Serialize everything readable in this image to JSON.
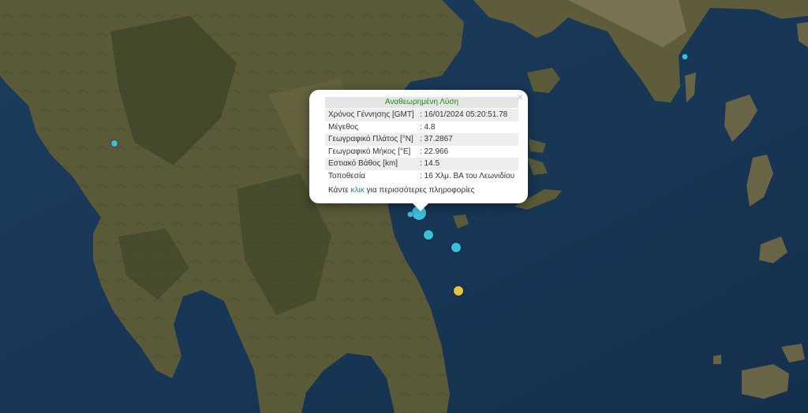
{
  "popup": {
    "title": "Αναθεωρημένη Λύση",
    "close_symbol": "×",
    "rows": [
      {
        "label": "Χρόνος Γέννησης [GMT]",
        "value": ": 16/01/2024 05:20:51.78"
      },
      {
        "label": "Μέγεθος",
        "value": ": 4.8"
      },
      {
        "label": "Γεωγραφικό Πλάτος [°N]",
        "value": ": 37.2867"
      },
      {
        "label": "Γεωγραφικό Μήκος [°E]",
        "value": ": 22.966"
      },
      {
        "label": "Εστιακό Βάθος [km]",
        "value": ": 14.5"
      },
      {
        "label": "Τοποθεσία",
        "value": ": 16 Χλμ. ΒΑ του Λεωνιδίου"
      }
    ],
    "more_prefix": "Κάντε ",
    "more_link": "κλικ",
    "more_suffix": " για περισσότερες πληροφορίες"
  },
  "colors": {
    "recent_event": "#3bbfd8",
    "older_event": "#e6c340",
    "title_text": "#1d8a1d",
    "link": "#1e7fb7"
  }
}
